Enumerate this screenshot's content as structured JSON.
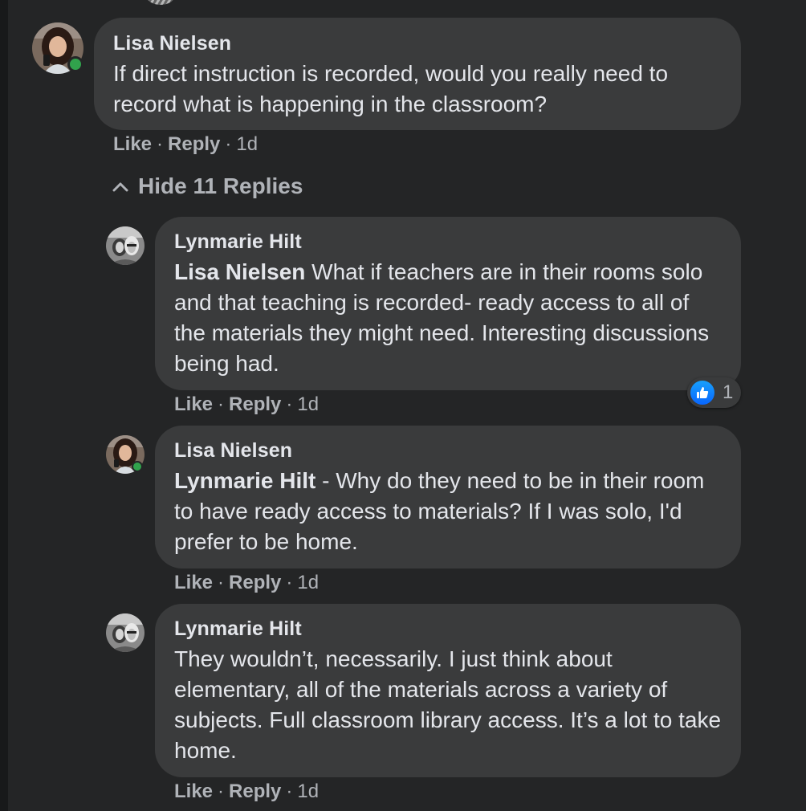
{
  "comments": {
    "main": {
      "author": "Lisa Nielsen",
      "text": "If direct instruction is recorded, would you really need to record what is happening in the classroom?",
      "like": "Like",
      "reply": "Reply",
      "sep": "·",
      "time": "1d"
    },
    "hide_replies": "Hide 11 Replies",
    "reply1": {
      "author": "Lynmarie Hilt",
      "mention": "Lisa Nielsen",
      "text": " What if teachers are in their rooms solo and that teaching is recorded- ready access to all of the materials they might need. Interesting discussions being had.",
      "like": "Like",
      "reply": "Reply",
      "sep": "·",
      "time": "1d",
      "reaction_count": "1"
    },
    "reply2": {
      "author": "Lisa Nielsen",
      "mention": "Lynmarie Hilt",
      "text": " - Why do they need to be in their room to have ready access to materials? If I was solo, I'd prefer to be home.",
      "like": "Like",
      "reply": "Reply",
      "sep": "·",
      "time": "1d"
    },
    "reply3": {
      "author": "Lynmarie Hilt",
      "text": "They wouldn’t, necessarily. I just think about elementary, all of the materials across a variety of subjects. Full classroom library access. It’s a lot to take home.",
      "like": "Like",
      "reply": "Reply",
      "sep": "·",
      "time": "1d"
    }
  },
  "colors": {
    "background": "#242526",
    "bubble": "#3a3b3c",
    "primary_text": "#e4e6eb",
    "secondary_text": "#b0b3b8",
    "online": "#31a24c",
    "like_blue": "#0866ff"
  }
}
